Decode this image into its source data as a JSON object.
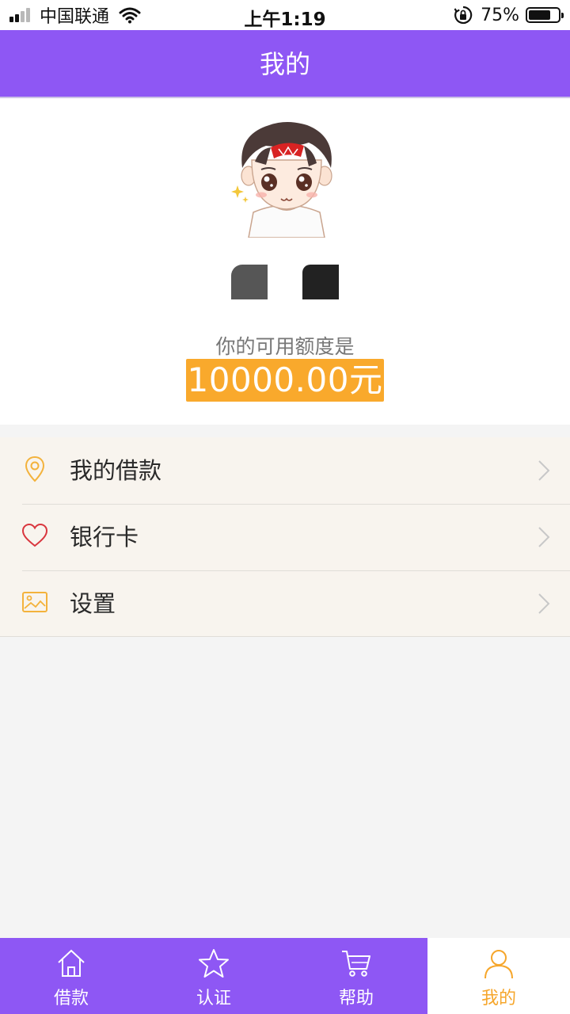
{
  "status_bar": {
    "carrier": "中国联通",
    "time": "上午1:19",
    "battery_percent": "75%",
    "battery_level": 0.75,
    "signal_bars_active": 2,
    "signal_bars_total": 4
  },
  "header": {
    "title": "我的"
  },
  "profile": {
    "credit_label": "你的可用额度是",
    "credit_amount": "10000.00元"
  },
  "menu": {
    "items": [
      {
        "label": "我的借款",
        "icon": "location-pin-icon",
        "icon_color": "#f3b23c"
      },
      {
        "label": "银行卡",
        "icon": "heart-icon",
        "icon_color": "#d9363e"
      },
      {
        "label": "设置",
        "icon": "image-icon",
        "icon_color": "#f3b23c"
      }
    ]
  },
  "tabbar": {
    "tabs": [
      {
        "label": "借款",
        "icon": "home-icon",
        "active": false
      },
      {
        "label": "认证",
        "icon": "star-icon",
        "active": false
      },
      {
        "label": "帮助",
        "icon": "cart-icon",
        "active": false
      },
      {
        "label": "我的",
        "icon": "user-icon",
        "active": true
      }
    ]
  },
  "colors": {
    "primary": "#8e57f4",
    "accent": "#f9a92c",
    "menu_bg": "#f8f4ee",
    "page_bg": "#f4f4f4"
  }
}
